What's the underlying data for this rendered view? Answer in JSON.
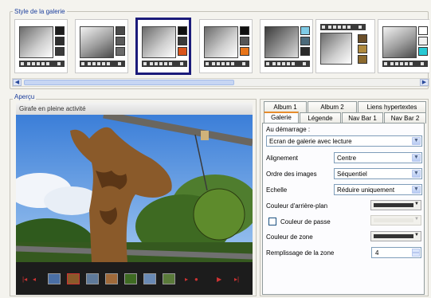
{
  "sections": {
    "gallery_style": "Style de la galerie",
    "preview": "Aperçu"
  },
  "preview": {
    "title": "Girafe en pleine activité"
  },
  "tabs": {
    "row1": [
      "Album 1",
      "Album 2",
      "Liens hypertextes"
    ],
    "row2": [
      "Galerie",
      "Légende",
      "Nav Bar 1",
      "Nav Bar 2"
    ],
    "active": "Galerie"
  },
  "settings": {
    "startup_label": "Au démarrage :",
    "startup_value": "Ecran de galerie avec lecture",
    "alignment_label": "Alignement",
    "alignment_value": "Centre",
    "order_label": "Ordre des images",
    "order_value": "Séquentiel",
    "scale_label": "Echelle",
    "scale_value": "Réduire uniquement",
    "bg_color_label": "Couleur d'arrière-plan",
    "pass_color_label": "Couleur de passe",
    "zone_color_label": "Couleur de zone",
    "zone_fill_label": "Remplissage de la zone",
    "zone_fill_value": "4"
  },
  "colors": {
    "accent": "#1a3d9c",
    "selected_border": "#1b1b7a",
    "tab_highlight": "#e68b2c",
    "swatches": [
      "#2b2b2b",
      "#7a7a7a",
      "#d9531b",
      "#e8751a",
      "#7fcbe6",
      "#6b4f2a",
      "#28c9d4"
    ]
  },
  "icons": [
    "chevron-left-icon",
    "chevron-right-icon",
    "dropdown-arrow-icon",
    "spin-up-icon",
    "spin-down-icon"
  ]
}
